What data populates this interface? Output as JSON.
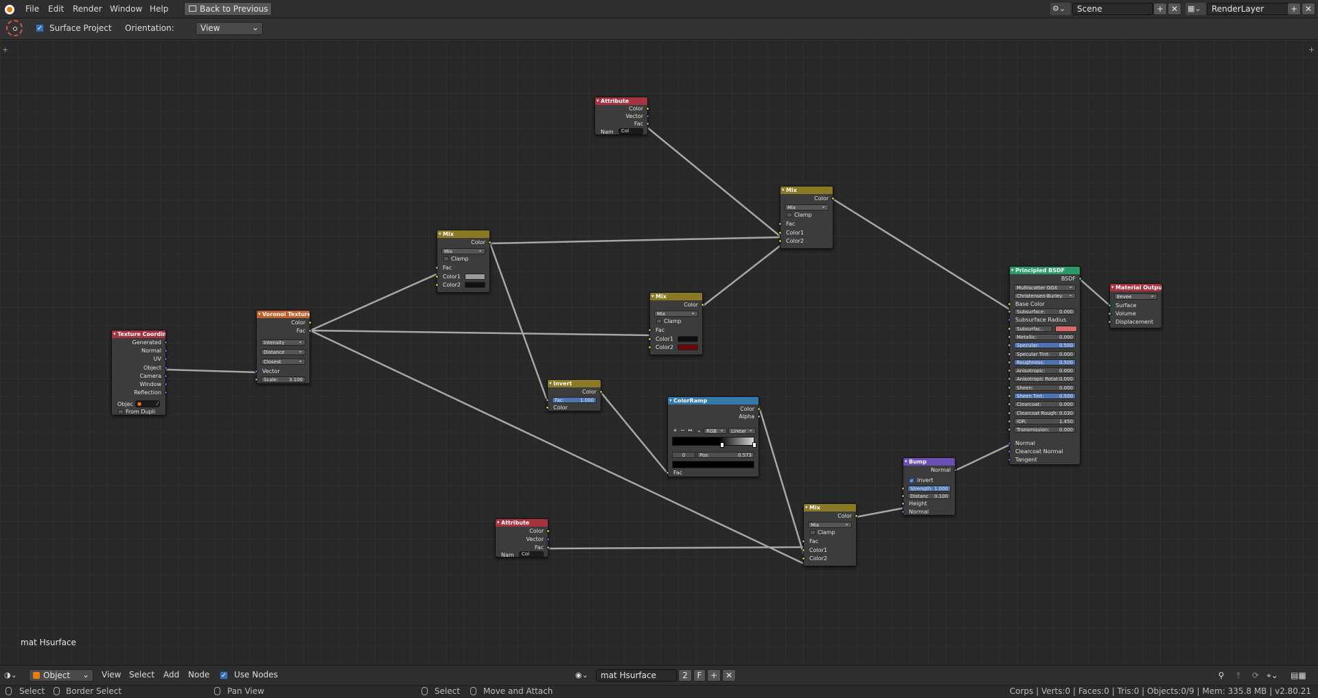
{
  "topbar": {
    "menus": [
      "File",
      "Edit",
      "Render",
      "Window",
      "Help"
    ],
    "back_button": "Back to Previous",
    "scene_name": "Scene",
    "render_layer": "RenderLayer"
  },
  "toolbar": {
    "surface_project_label": "Surface Project",
    "surface_project_checked": true,
    "orientation_label": "Orientation:",
    "orientation_value": "View"
  },
  "canvas": {
    "material_label": "mat Hsurface"
  },
  "nodes": {
    "attr1": {
      "title": "Attribute",
      "outputs": [
        "Color",
        "Vector",
        "Fac"
      ],
      "name_label": "Nam",
      "name_value": "Col"
    },
    "mix1": {
      "title": "Mix",
      "output": "Color",
      "blend": "Mix",
      "clamp": "Clamp",
      "inputs": [
        "Fac",
        "Color1",
        "Color2"
      ]
    },
    "mix2": {
      "title": "Mix",
      "output": "Color",
      "blend": "Mix",
      "clamp": "Clamp",
      "inputs": [
        "Fac",
        "Color1",
        "Color2"
      ]
    },
    "mix3": {
      "title": "Mix",
      "output": "Color",
      "blend": "Mix",
      "clamp": "Clamp",
      "inputs": [
        "Fac",
        "Color1",
        "Color2"
      ]
    },
    "mix4": {
      "title": "Mix",
      "output": "Color",
      "blend": "Mix",
      "clamp": "Clamp",
      "inputs": [
        "Fac",
        "Color1",
        "Color2"
      ]
    },
    "texcoord": {
      "title": "Texture Coordin...",
      "outputs": [
        "Generated",
        "Normal",
        "UV",
        "Object",
        "Camera",
        "Window",
        "Reflection"
      ],
      "object_label": "Objec",
      "from_dupli": "From Dupli"
    },
    "voronoi": {
      "title": "Voronoi Texture",
      "outputs": [
        "Color",
        "Fac"
      ],
      "dropdowns": [
        "Intensity",
        "Distance",
        "Closest"
      ],
      "input": "Vector",
      "scale_label": "Scale:",
      "scale_value": "3.100"
    },
    "invert": {
      "title": "Invert",
      "output": "Color",
      "fac_label": "Fac:",
      "fac_value": "1.000",
      "input": "Color"
    },
    "colorramp": {
      "title": "ColorRamp",
      "outputs": [
        "Color",
        "Alpha"
      ],
      "mode": "RGB",
      "interp": "Linear",
      "index": "0",
      "pos_label": "Pos:",
      "pos_value": "0.573",
      "input": "Fac"
    },
    "attr2": {
      "title": "Attribute",
      "outputs": [
        "Color",
        "Vector",
        "Fac"
      ],
      "name_label": "Nam",
      "name_value": "Col"
    },
    "bump": {
      "title": "Bump",
      "output": "Normal",
      "invert": "Invert",
      "strength_label": "Strength:",
      "strength_value": "1.000",
      "distance_label": "Distanc",
      "distance_value": "0.100",
      "inputs": [
        "Height",
        "Normal"
      ]
    },
    "bsdf": {
      "title": "Principled BSDF",
      "output": "BSDF",
      "distribution": "Multiscatter GGX",
      "subsurface_method": "Christensen-Burley",
      "base_color": "Base Color",
      "rows": [
        {
          "label": "Subsurface:",
          "value": "0.000",
          "hi": false
        },
        {
          "label": "Subsurface Radius",
          "value": "",
          "hi": false
        },
        {
          "label": "Subsurfac..",
          "value": "",
          "hi": false
        },
        {
          "label": "Metallic:",
          "value": "0.000",
          "hi": false
        },
        {
          "label": "Specular:",
          "value": "0.500",
          "hi": true
        },
        {
          "label": "Specular Tint:",
          "value": "0.000",
          "hi": false
        },
        {
          "label": "Roughness:",
          "value": "0.500",
          "hi": true
        },
        {
          "label": "Anisotropic:",
          "value": "0.000",
          "hi": false
        },
        {
          "label": "Anisotropic Rotat:",
          "value": "0.000",
          "hi": false
        },
        {
          "label": "Sheen:",
          "value": "0.000",
          "hi": false
        },
        {
          "label": "Sheen Tint:",
          "value": "0.500",
          "hi": true
        },
        {
          "label": "Clearcoat:",
          "value": "0.000",
          "hi": false
        },
        {
          "label": "Clearcoat Rough:",
          "value": "0.030",
          "hi": false
        },
        {
          "label": "IOR:",
          "value": "1.450",
          "hi": false
        },
        {
          "label": "Transmission:",
          "value": "0.000",
          "hi": false
        }
      ],
      "tail_inputs": [
        "Normal",
        "Clearcoat Normal",
        "Tangent"
      ]
    },
    "output": {
      "title": "Material Output",
      "engine": "Eevee",
      "inputs": [
        "Surface",
        "Volume",
        "Displacement"
      ]
    }
  },
  "bottombar": {
    "mode": "Object",
    "menus": [
      "View",
      "Select",
      "Add",
      "Node"
    ],
    "use_nodes": "Use Nodes",
    "material_name": "mat Hsurface",
    "users": "2",
    "fake_user": "F"
  },
  "statusbar": {
    "select": "Select",
    "border_select": "Border Select",
    "pan_view": "Pan View",
    "select2": "Select",
    "move_attach": "Move and Attach",
    "stats": "Corps | Verts:0 | Faces:0 | Tris:0 | Objects:0/9 | Mem: 335.8 MB | v2.80.21"
  },
  "colors": {
    "attribute_header": "#a83340",
    "mix_header": "#8a7a25",
    "texcoord_header": "#a83340",
    "voronoi_header": "#c0612a",
    "invert_header": "#8a7a25",
    "colorramp_header": "#3479a9",
    "bump_header": "#6a4fb5",
    "bsdf_header": "#2b9a68",
    "output_header": "#a83340",
    "wire": "#a8a8a8"
  }
}
